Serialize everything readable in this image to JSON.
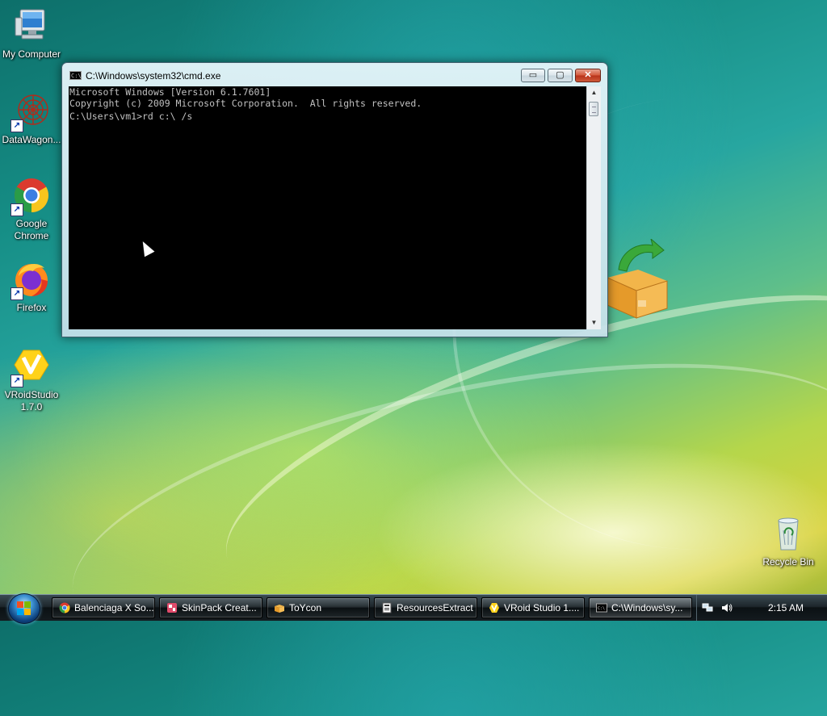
{
  "desktop": {
    "icons": [
      {
        "label": "My Computer"
      },
      {
        "label": "DataWagon..."
      },
      {
        "label": "Google Chrome"
      },
      {
        "label": "Firefox"
      },
      {
        "label": "VRoidStudio 1.7.0"
      },
      {
        "label": "Recycle Bin"
      }
    ]
  },
  "cmd_window": {
    "title": "C:\\Windows\\system32\\cmd.exe",
    "icon_text": "C:\\",
    "buttons": {
      "minimize": "▭",
      "maximize": "▢",
      "close": "✕"
    },
    "lines": [
      "Microsoft Windows [Version 6.1.7601]",
      "Copyright (c) 2009 Microsoft Corporation.  All rights reserved.",
      "",
      "C:\\Users\\vm1>rd c:\\ /s"
    ],
    "scroll_up": "▲",
    "scroll_down": "▼"
  },
  "taskbar": {
    "tasks": [
      {
        "label": "Balenciaga X So...",
        "icon": "chrome-icon"
      },
      {
        "label": "SkinPack Creat...",
        "icon": "skinpack-icon"
      },
      {
        "label": "ToYcon",
        "icon": "box-icon"
      },
      {
        "label": "ResourcesExtract",
        "icon": "resources-icon"
      },
      {
        "label": "VRoid Studio 1....",
        "icon": "vroid-icon"
      },
      {
        "label": "C:\\Windows\\sy...",
        "icon": "cmd-icon",
        "active": true
      }
    ],
    "clock": "2:15 AM"
  }
}
